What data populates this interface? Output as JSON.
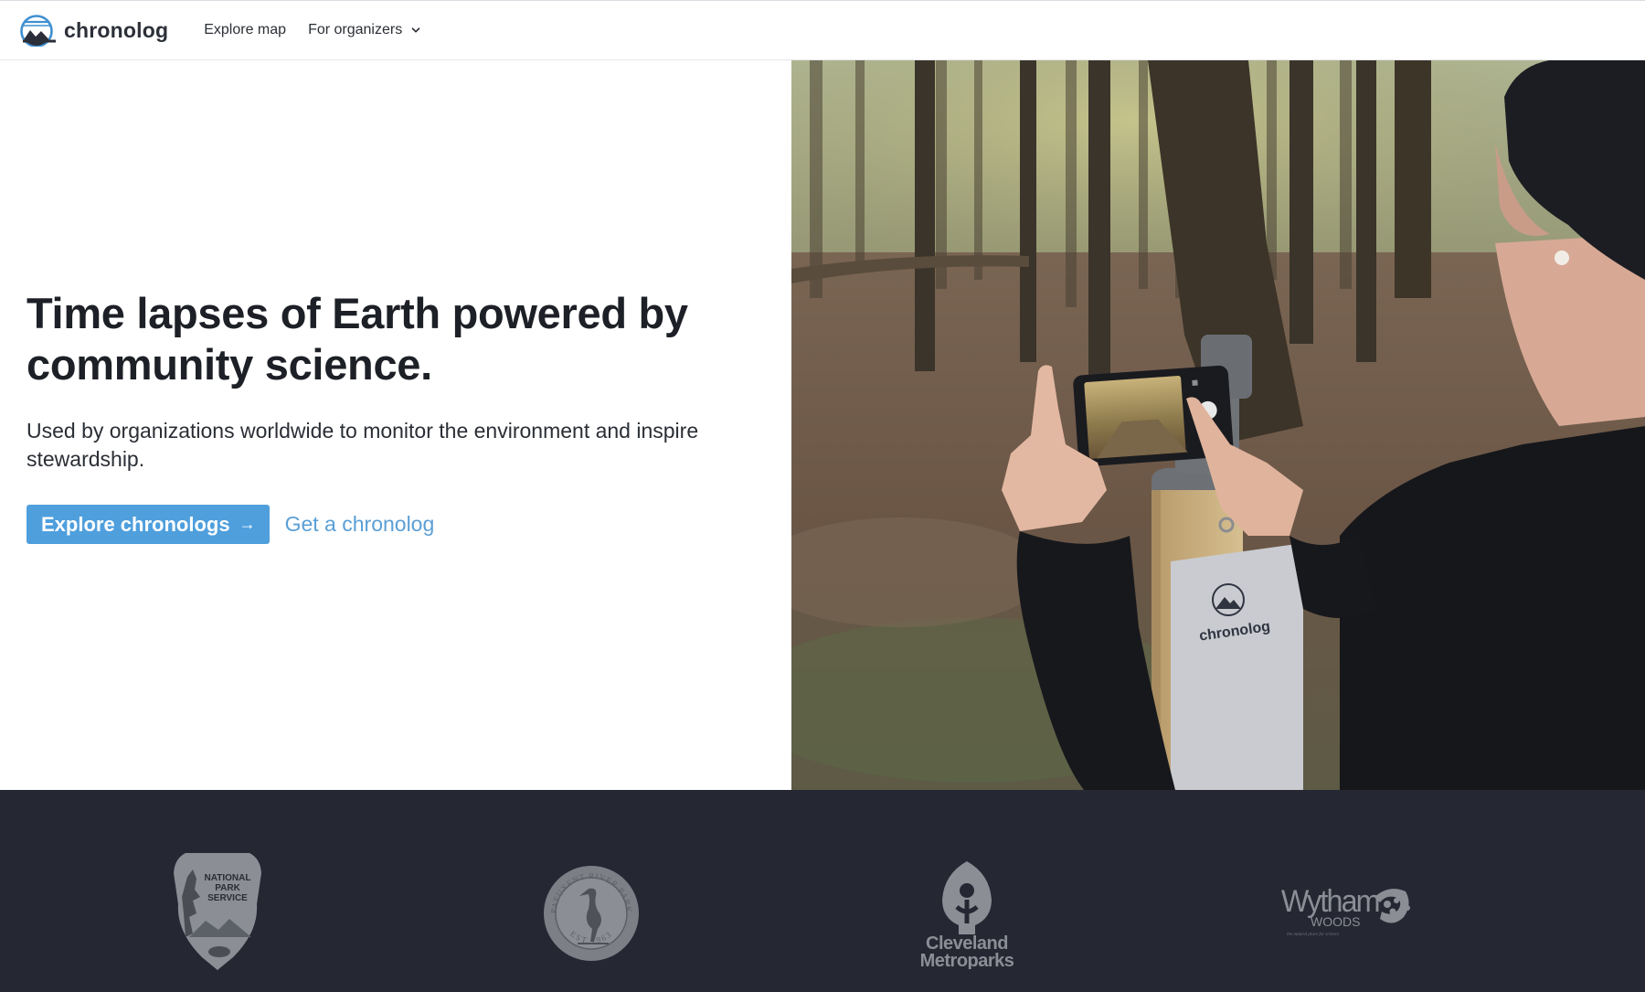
{
  "header": {
    "brand_name": "chronolog",
    "nav": {
      "explore_map": "Explore map",
      "for_organizers": "For organizers"
    }
  },
  "hero": {
    "title": "Time lapses of Earth powered by community science.",
    "subtitle": "Used by organizations worldwide to monitor the environment and inspire stewardship.",
    "primary_cta": "Explore chronologs",
    "primary_cta_icon": "arrow-right-icon",
    "secondary_cta": "Get a chronolog",
    "photo_sign_text": "chronolog"
  },
  "partners": {
    "logos": [
      {
        "name": "National Park Service",
        "lines": [
          "NATIONAL",
          "PARK",
          "SERVICE"
        ]
      },
      {
        "name": "River Park seal",
        "ring_top": "PATUXENT RIVER PARK",
        "ring_bottom": "EST 1963"
      },
      {
        "name": "Cleveland Metroparks",
        "lines": [
          "Cleveland",
          "Metroparks"
        ]
      },
      {
        "name": "Wytham Woods",
        "lines": [
          "Wytham",
          "WOODS"
        ],
        "tagline": "the natural place for science"
      }
    ]
  },
  "colors": {
    "primary_button": "#4f9fdd",
    "link": "#5a9fd6",
    "partners_bg": "#252833",
    "logo_gray": "#8b8e95"
  }
}
